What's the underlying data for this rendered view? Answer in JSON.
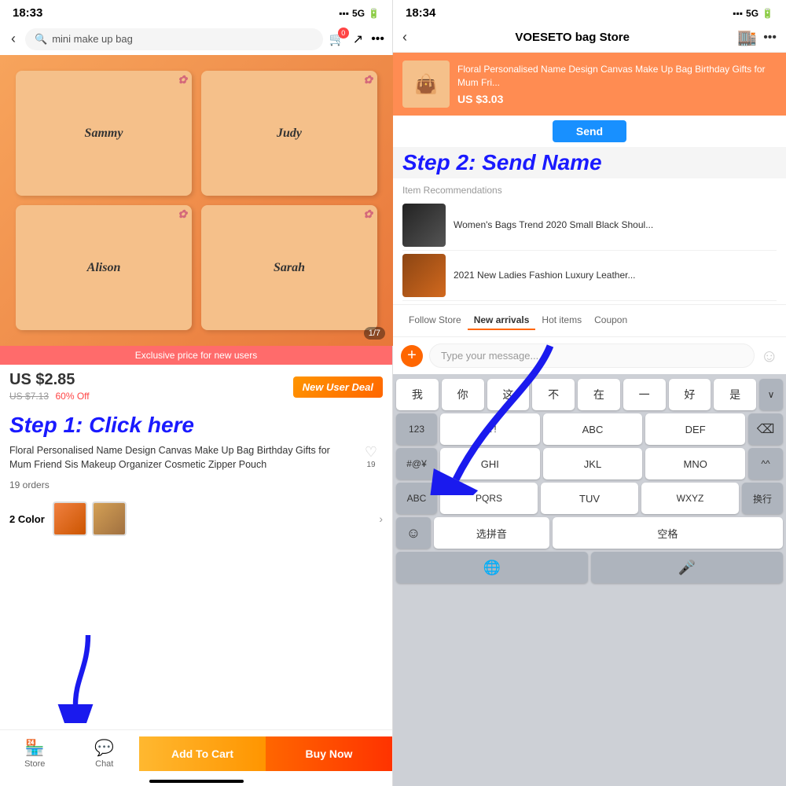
{
  "left": {
    "status_time": "18:33",
    "signal": "5G",
    "search_placeholder": "mini make up bag",
    "cart_badge": "0",
    "product_image_counter": "1/7",
    "exclusive_banner": "Exclusive price for new users",
    "current_price": "US $2.85",
    "original_price": "US $7.13",
    "discount": "60% Off",
    "new_user_deal": "New User Deal",
    "step1_label": "Step 1: Click here",
    "product_title": "Floral Personalised Name Design Canvas Make Up Bag Birthday Gifts for Mum Friend Sis Makeup Organizer Cosmetic Zipper Pouch",
    "wishlist_count": "19",
    "orders_text": "19 orders",
    "color_label": "2 Color",
    "bag_names": [
      "Sammy",
      "Judy",
      "Alison",
      "Sarah"
    ],
    "add_to_cart": "Add To Cart",
    "buy_now": "Buy Now",
    "nav_store": "Store",
    "nav_chat": "Chat"
  },
  "right": {
    "status_time": "18:34",
    "signal": "5G",
    "store_name": "VOESETO bag Store",
    "product_card_title": "Floral Personalised Name Design Canvas Make Up Bag Birthday Gifts for Mum Fri...",
    "product_card_price": "US $3.03",
    "send_label": "Send",
    "step2_label": "Step 2: Send Name",
    "rec_title": "Item Recommendations",
    "rec_items": [
      {
        "title": "Women's Bags Trend 2020 Small Black Shoul..."
      },
      {
        "title": "2021 New Ladies Fashion Luxury Leather..."
      }
    ],
    "tabs": [
      "Follow Store",
      "New arrivals",
      "Hot items",
      "Coupon"
    ],
    "message_placeholder": "Type your message...",
    "keyboard_row1": [
      "我",
      "你",
      "这",
      "不",
      "在",
      "一",
      "好",
      "是"
    ],
    "keyboard_row2_left": "123",
    "keyboard_row2_mid": ",.?!",
    "keyboard_row2_r1": "ABC",
    "keyboard_row2_r2": "DEF",
    "keyboard_row3_l": "#@¥",
    "keyboard_row3_m1": "GHI",
    "keyboard_row3_m2": "JKL",
    "keyboard_row3_m3": "MNO",
    "keyboard_row3_r": "^^",
    "keyboard_row4_l": "ABC",
    "keyboard_row4_m1": "PQRS",
    "keyboard_row4_m2": "TUV",
    "keyboard_row4_m3": "WXYZ",
    "keyboard_row4_r": "换行",
    "keyboard_row5_emoji": "☺",
    "keyboard_row5_pinyin": "选拼音",
    "keyboard_row5_space": "空格",
    "keyboard_row6_globe": "🌐",
    "keyboard_row6_mic": "🎤"
  }
}
